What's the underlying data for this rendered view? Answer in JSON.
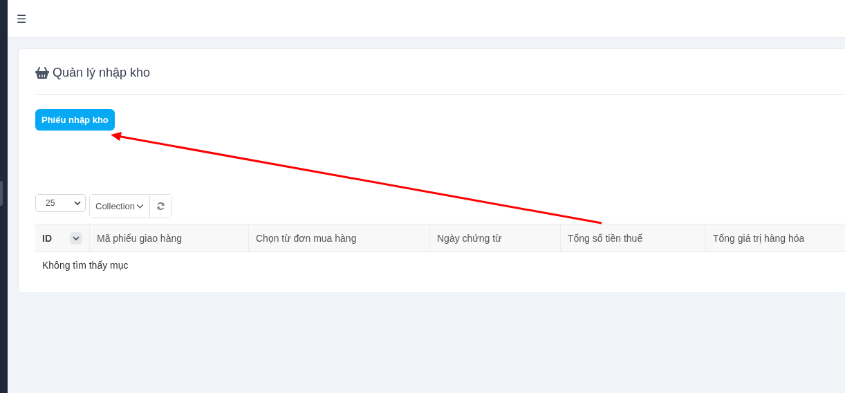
{
  "header": {
    "menu_icon": "☰"
  },
  "card": {
    "title": "Quản lý nhập kho",
    "primary_button": "Phiếu nhập kho"
  },
  "toolbar": {
    "page_size": "25",
    "collection_button": "Collection"
  },
  "table": {
    "columns": [
      {
        "label": "ID",
        "kind": "sortable"
      },
      {
        "label": "Mã phiếu giao hàng",
        "kind": "plain"
      },
      {
        "label": "Chọn từ đơn mua hàng",
        "kind": "plain"
      },
      {
        "label": "Ngày chứng từ",
        "kind": "plain"
      },
      {
        "label": "Tổng số tiền thuế",
        "kind": "plain"
      },
      {
        "label": "Tổng giá trị hàng hóa",
        "kind": "plain"
      }
    ],
    "empty_message": "Không tìm thấy mục"
  }
}
